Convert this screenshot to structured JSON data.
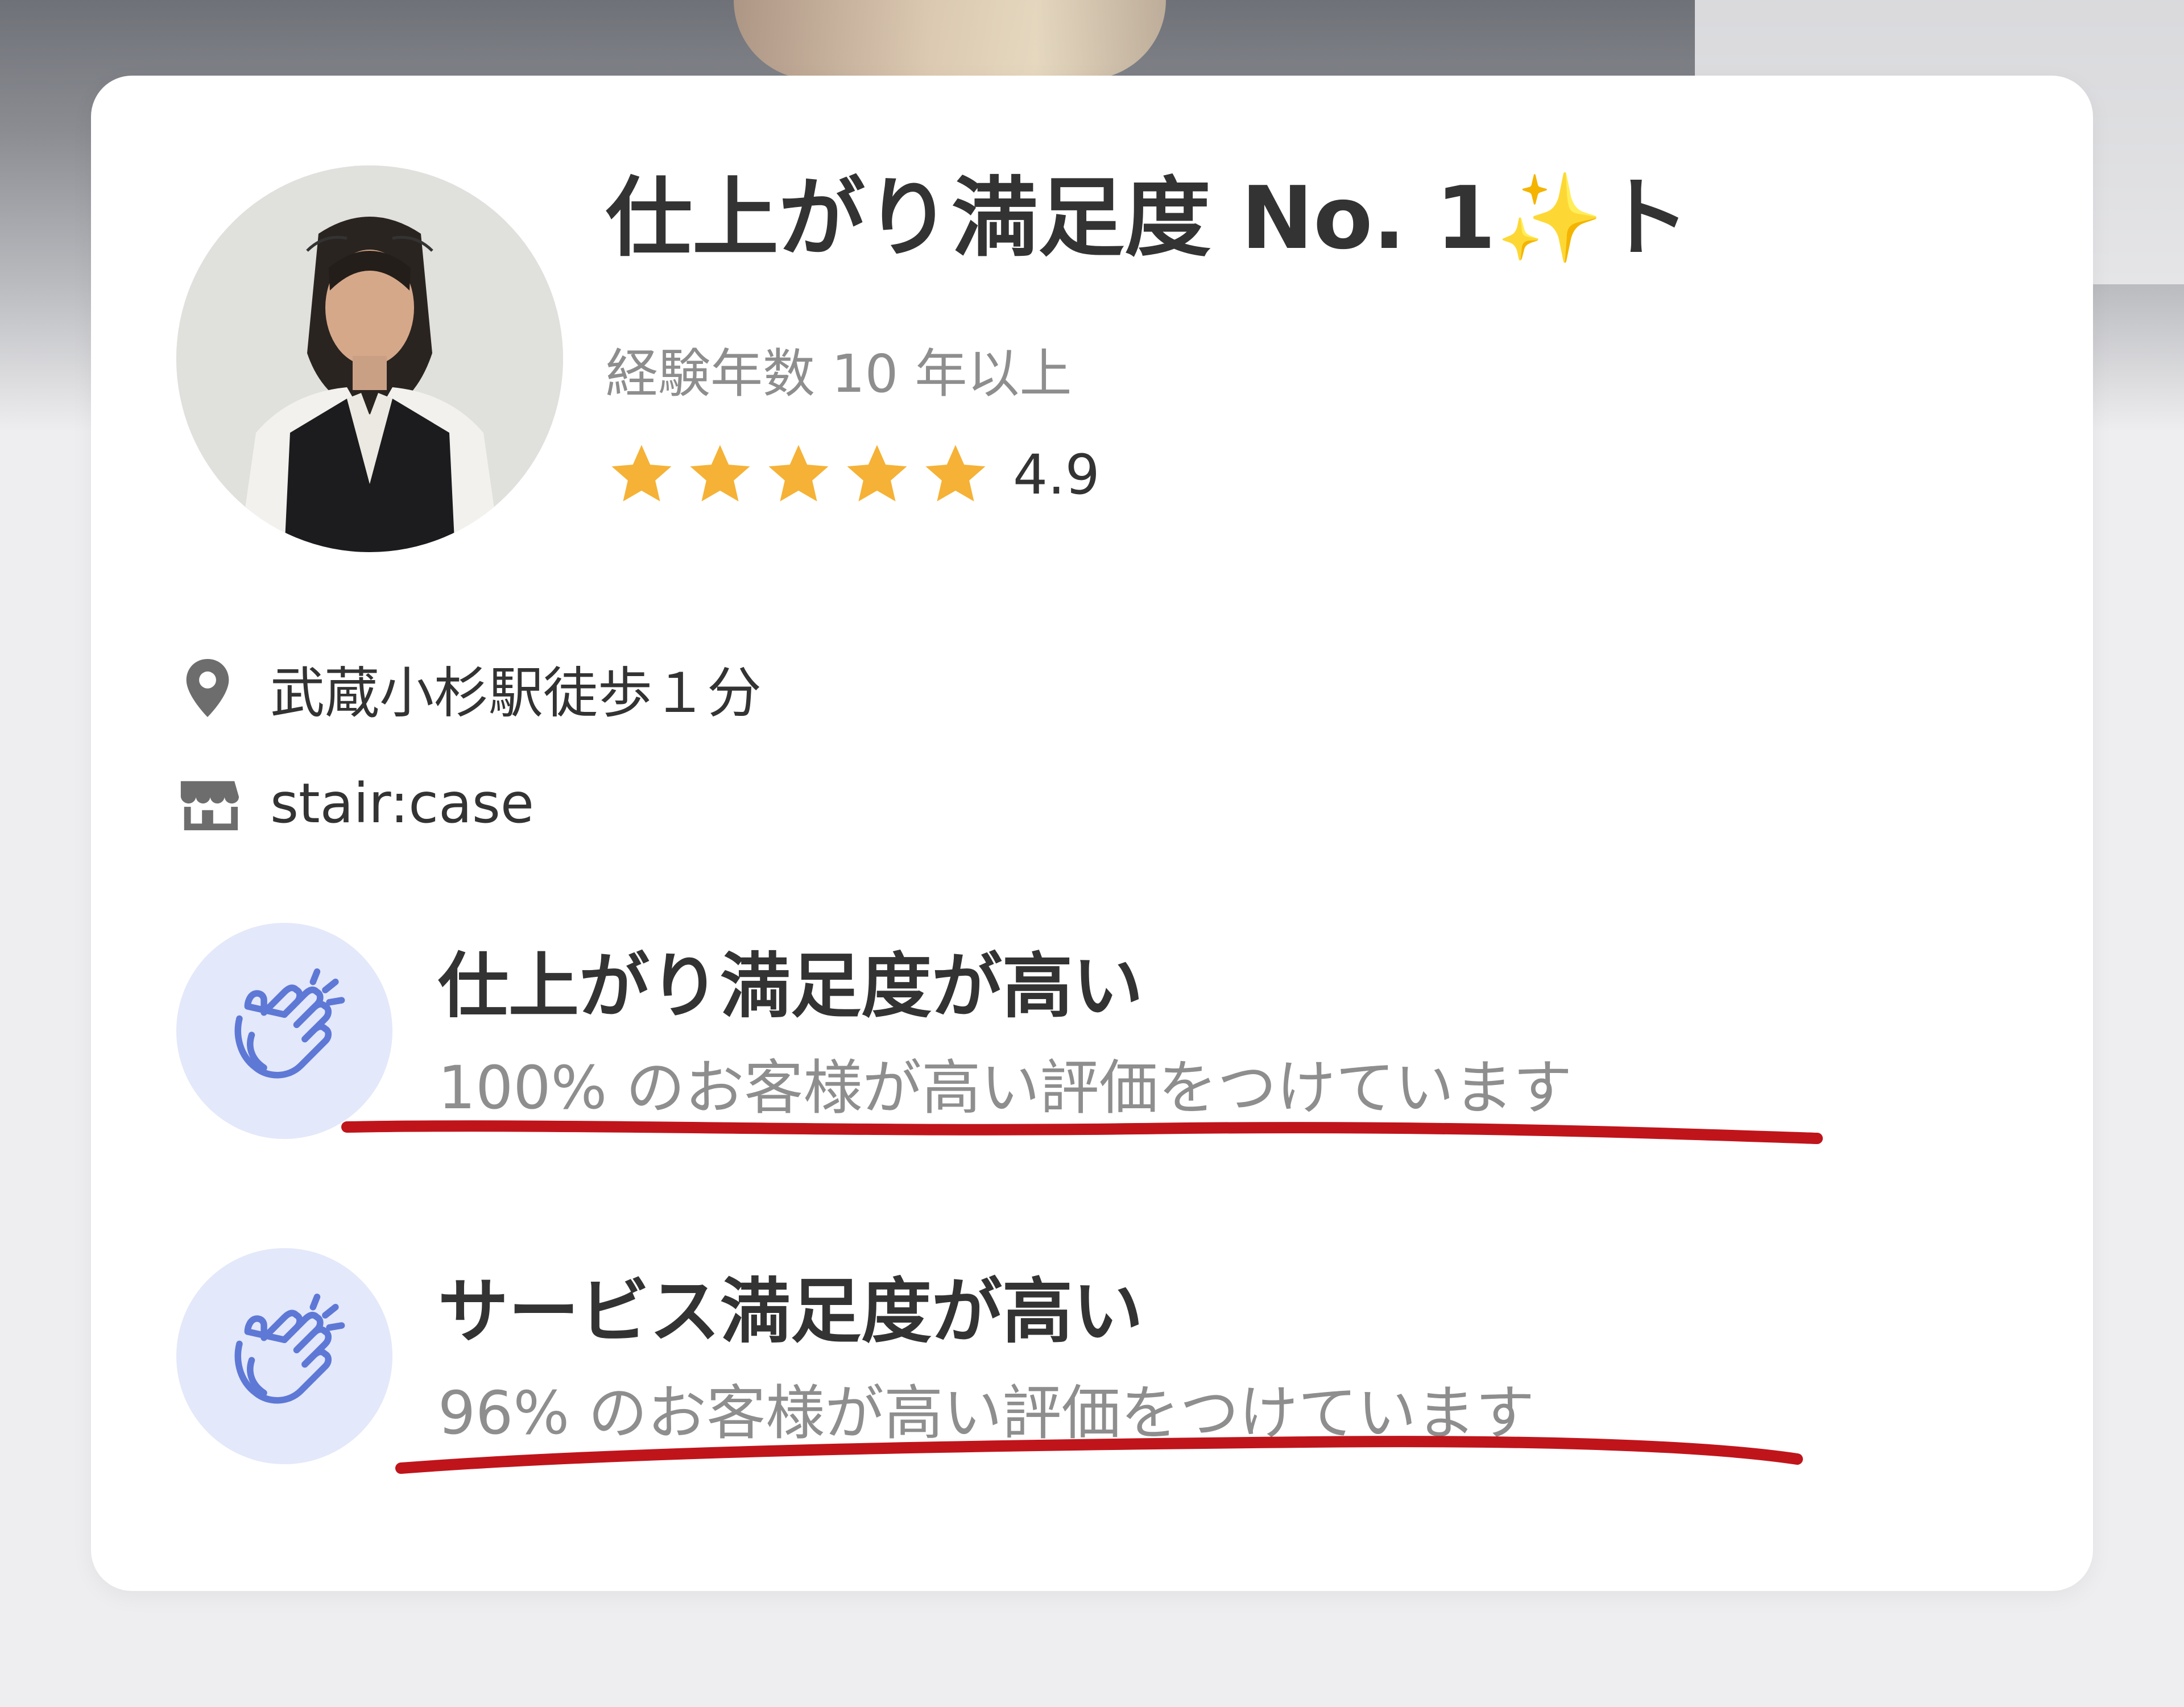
{
  "stylist": {
    "headline": "仕上がり満足度 No. 1✨ト",
    "experience": "経験年数 10 年以上",
    "rating_value": "4.9",
    "rating_stars": 5
  },
  "info": {
    "location": "武蔵小杉駅徒歩１分",
    "salon": "stair:case"
  },
  "features": [
    {
      "title": "仕上がり満足度が高い",
      "description": "100% のお客様が高い評価をつけています"
    },
    {
      "title": "サービス満足度が高い",
      "description": "96% のお客様が高い評価をつけています"
    }
  ],
  "colors": {
    "star": "#f5b236",
    "accent_underline": "#c0141b",
    "feature_circle": "#e3e8fa",
    "feature_icon": "#5e78d6",
    "text_primary": "#333333",
    "text_secondary": "#8e8e8e"
  },
  "icons": {
    "location": "map-pin-icon",
    "salon": "storefront-icon",
    "feature": "clapping-hands-icon"
  }
}
